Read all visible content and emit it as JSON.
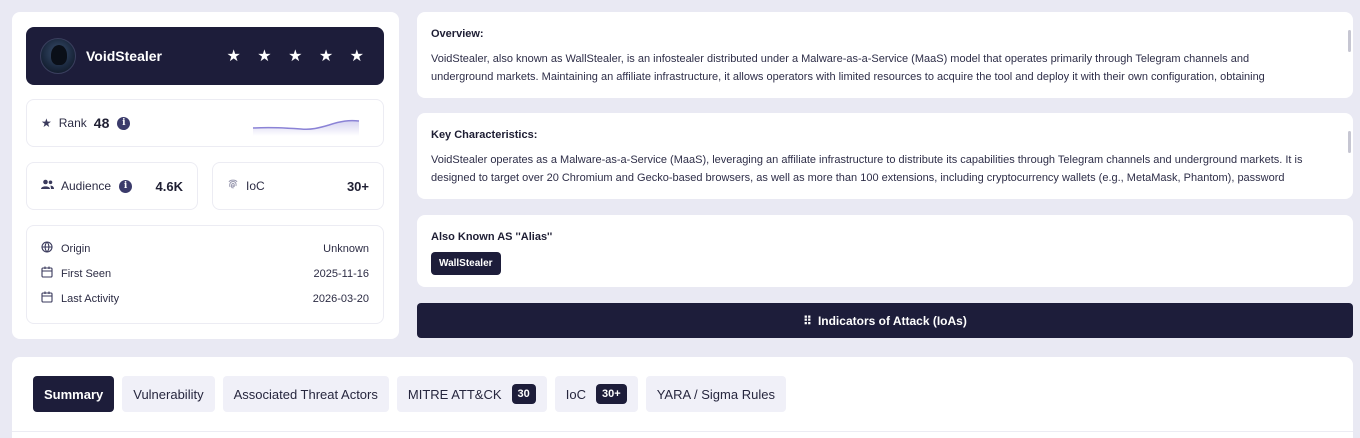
{
  "profile": {
    "name": "VoidStealer",
    "stars": "★ ★ ★ ★ ★",
    "rating": 5
  },
  "rank": {
    "label": "Rank",
    "value": "48",
    "info": "i"
  },
  "audience": {
    "label": "Audience",
    "value": "4.6K",
    "info": "i"
  },
  "ioc": {
    "label": "IoC",
    "value": "30+"
  },
  "meta": {
    "origin_label": "Origin",
    "origin_value": "Unknown",
    "first_seen_label": "First Seen",
    "first_seen_value": "2025-11-16",
    "last_activity_label": "Last Activity",
    "last_activity_value": "2026-03-20"
  },
  "overview": {
    "title": "Overview:",
    "text": "VoidStealer, also known as WallStealer, is an infostealer distributed under a Malware-as-a-Service (MaaS) model that operates primarily through Telegram channels and underground markets. Maintaining an affiliate infrastructure, it allows operators with limited resources to acquire the tool and deploy it with their own configuration, obtaining"
  },
  "key_characteristics": {
    "title": "Key Characteristics:",
    "text": "VoidStealer operates as a Malware-as-a-Service (MaaS), leveraging an affiliate infrastructure to distribute its capabilities through Telegram channels and underground markets. It is designed to target over 20 Chromium and Gecko-based browsers, as well as more than 100 extensions, including cryptocurrency wallets (e.g., MetaMask, Phantom), password"
  },
  "alias": {
    "title": "Also Known AS ''Alias''",
    "items": [
      "WallStealer"
    ]
  },
  "ioa_button": {
    "label": "Indicators of Attack (IoAs)"
  },
  "tabs": {
    "summary": "Summary",
    "vulnerability": "Vulnerability",
    "threat_actors": "Associated Threat Actors",
    "mitre": "MITRE ATT&CK",
    "mitre_count": "30",
    "ioc": "IoC",
    "ioc_count": "30+",
    "yara": "YARA / Sigma Rules"
  },
  "colors": {
    "navy": "#1d1d3a",
    "accent": "#8b83d6"
  }
}
